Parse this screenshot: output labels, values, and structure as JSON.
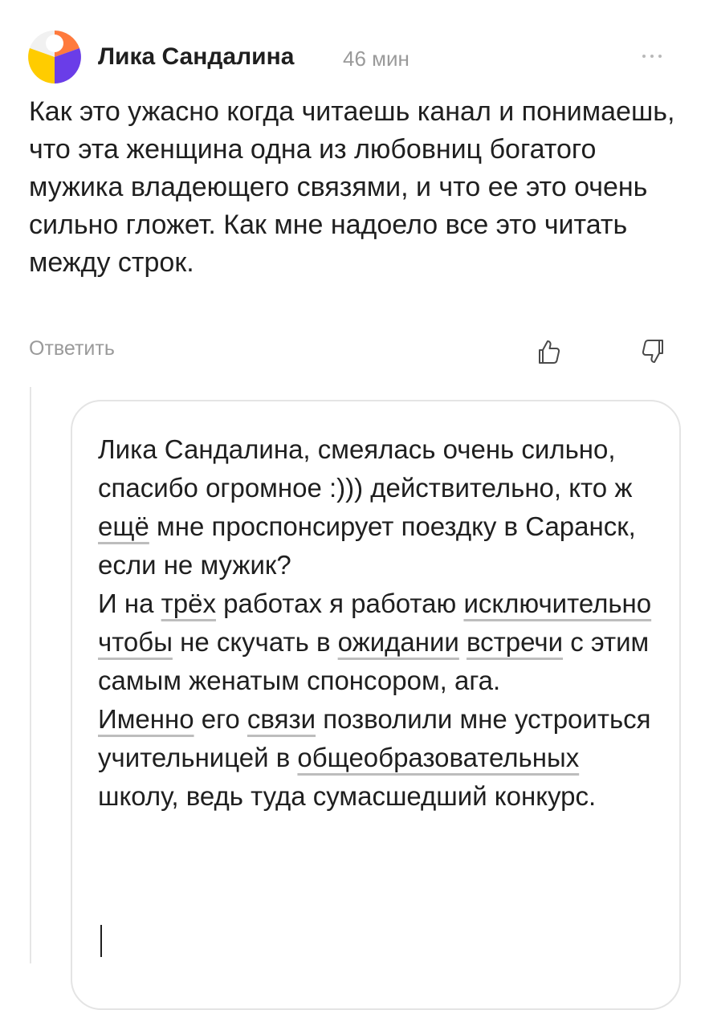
{
  "comment": {
    "author": "Лика Сандалина",
    "time": "46 мин",
    "text": "Как это ужасно когда читаешь канал и понимаешь, что эта женщина одна из любовниц богатого мужика владеющего связями, и что ее это очень сильно гложет. Как мне надоело все это читать между строк.",
    "reply_label": "Ответить",
    "icons": {
      "avatar": "avatar-logo",
      "more": "more-icon",
      "like": "thumbs-up-icon",
      "dislike": "thumbs-down-icon"
    }
  },
  "reply_editor": {
    "p1": "Лика Сандалина, смеялась очень сильно, спасибо огромное :))) действительно, кто ж ",
    "w1": "ещё",
    "p2": " мне проспонсирует поездку в Саранск, если не мужик?\nИ на ",
    "w2": "трёх",
    "p3": " работах я работаю ",
    "w3": "исключительно",
    "p4": " ",
    "w4": "чтобы",
    "p5": " не скучать в ",
    "w5": "ожидании",
    "p6": " ",
    "w6": "встречи",
    "p7": " с этим самым женатым спонсором, ага.\n",
    "w7": "Именно",
    "p8": " его ",
    "w8": "связи",
    "p9": " позволили мне устроиться учительницей в ",
    "w9": "общеобразовательных",
    "p10": " школу, ведь туда сумасшедший конкурс."
  },
  "colors": {
    "text": "#1f1f1f",
    "muted": "#9a9a9a",
    "border": "#e4e4e4",
    "avatar_orange": "#ff7a3d",
    "avatar_yellow": "#ffcc00",
    "avatar_purple": "#6a3de8"
  }
}
